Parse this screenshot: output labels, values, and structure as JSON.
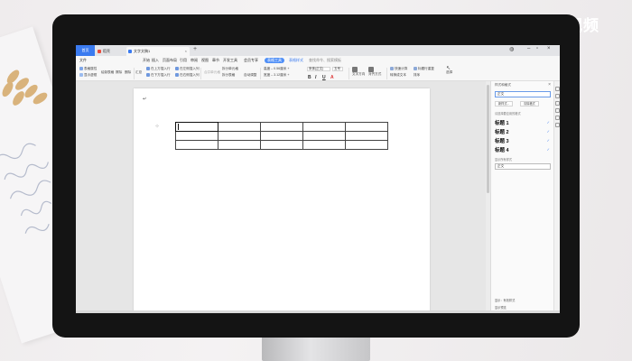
{
  "watermark": "天奇·视频",
  "titlebar": {
    "home_tab": "首页",
    "tab_wps": "稻壳",
    "tab_doc": "文字文稿1",
    "close_glyph": "×",
    "add_glyph": "+"
  },
  "menu": {
    "items": [
      "文件",
      "开始",
      "插入",
      "页面布局",
      "引用",
      "审阅",
      "视图",
      "章节",
      "开发工具",
      "会员专享"
    ],
    "active_pill": "表格工具",
    "secondary_pill": "表格样式",
    "search": "查找命令、搜索模板"
  },
  "ribbon": {
    "buttons": [
      "表格属性",
      "显示虚框",
      "绘制表格",
      "擦除",
      "删除",
      "汇总",
      "在上方插入行",
      "在下方插入行",
      "在左侧插入列",
      "在右侧插入列",
      "合并单元格",
      "拆分单元格",
      "拆分表格",
      "自动调整",
      "高度",
      "宽度",
      "宋体(正文)",
      "五号",
      "文字方向",
      "对齐方式",
      "快速计算",
      "标题行重复",
      "转换成文本",
      "排序",
      "选择"
    ],
    "bold": "B",
    "italic": "I",
    "underline": "U",
    "colors": {
      "accent": "#3b7bf0",
      "pill": "#4f8ff7"
    }
  },
  "document": {
    "header_mark": "↵",
    "rows": 3,
    "cols": 5
  },
  "pane": {
    "title": "样式和格式",
    "current_style": "正文",
    "new_style": "新样式...",
    "clear_format": "清除格式",
    "section_label": "请选择要应用的格式",
    "styles": [
      "标题 1",
      "标题 2",
      "标题 3",
      "标题 4"
    ],
    "section_label2": "显示所有样式",
    "current_field": "正文",
    "footer1": "显示：有效样式",
    "footer2": "显示预览"
  }
}
